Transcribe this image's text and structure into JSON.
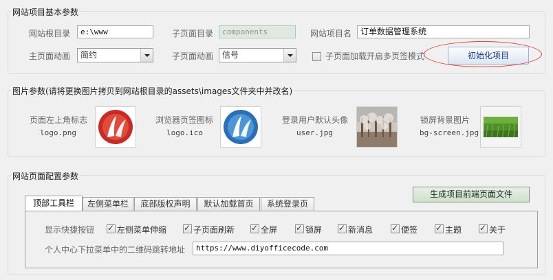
{
  "basic": {
    "title": "网站项目基本参数",
    "root_dir_label": "网站根目录",
    "root_dir_value": "e:\\www",
    "sub_dir_label": "子页面目录",
    "sub_dir_value": "components",
    "project_name_label": "网站项目名",
    "project_name_value": "订单数据管理系统",
    "main_anim_label": "主页面动画",
    "main_anim_value": "简约",
    "sub_anim_label": "子页面动画",
    "sub_anim_value": "信号",
    "multi_tab_label": "子页面加载开启多页签模式",
    "init_button": "初始化项目"
  },
  "images": {
    "title": "图片参数(请将更换图片拷贝到网站根目录的assets\\images文件夹中并改名)",
    "items": [
      {
        "label": "页面左上角标志",
        "file": "logo.png",
        "icon": "logo-image"
      },
      {
        "label": "浏览器页签图标",
        "file": "logo.ico",
        "icon": "favicon-image"
      },
      {
        "label": "登录用户默认头像",
        "file": "user.jpg",
        "icon": "avatar-image"
      },
      {
        "label": "锁屏背景图片",
        "file": "bg-screen.jpg",
        "icon": "lock-screen-image"
      }
    ]
  },
  "pages": {
    "title": "网站页面配置参数",
    "generate_button": "生成项目前端页面文件",
    "tabs": [
      "顶部工具栏",
      "左侧菜单栏",
      "底部版权声明",
      "默认加载首页",
      "系统登录页"
    ],
    "shortcut_label": "显示快捷按钮",
    "shortcuts": [
      "左侧菜单伸缩",
      "子页面刷新",
      "全屏",
      "锁屏",
      "新消息",
      "便签",
      "主题",
      "关于"
    ],
    "qr_label": "个人中心下拉菜单中的二维码跳转地址",
    "qr_value": "https://www.diyofficecode.com"
  },
  "colors": {
    "annotation": "#e53935",
    "init_button_text": "#1a3a8a"
  }
}
